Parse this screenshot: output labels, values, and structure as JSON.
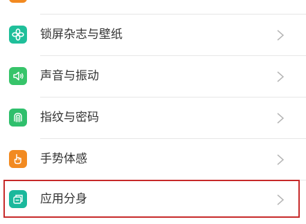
{
  "settings": {
    "items": [
      {
        "label": "锁屏杂志与壁纸",
        "icon": "flower-icon",
        "color": "#1fbf9a"
      },
      {
        "label": "声音与振动",
        "icon": "speaker-icon",
        "color": "#37c46a"
      },
      {
        "label": "指纹与密码",
        "icon": "fingerprint-icon",
        "color": "#2fbf6c"
      },
      {
        "label": "手势体感",
        "icon": "hand-gesture-icon",
        "color": "#f28a21"
      },
      {
        "label": "应用分身",
        "icon": "app-clone-icon",
        "color": "#1ab89c"
      }
    ]
  },
  "highlight_color": "#c62828",
  "chevron_icon": "chevron-right-icon"
}
